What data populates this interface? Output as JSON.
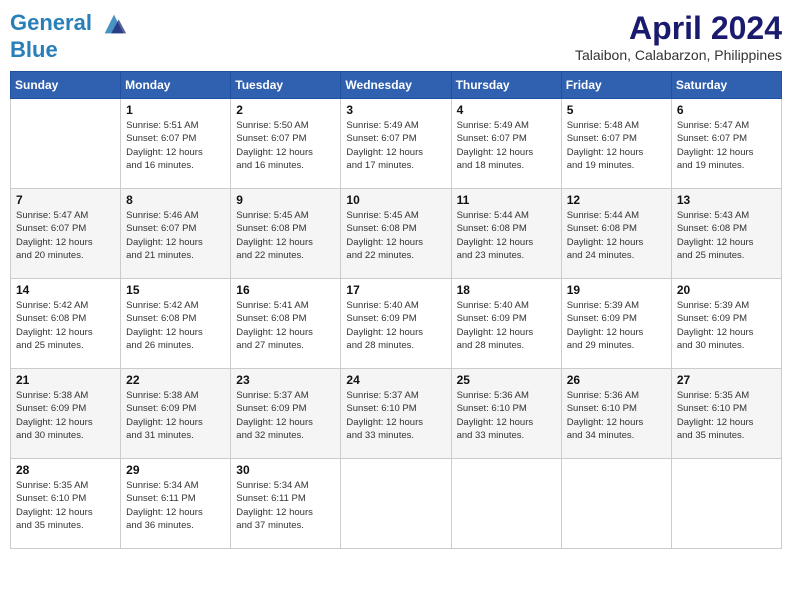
{
  "header": {
    "logo_line1": "General",
    "logo_line2": "Blue",
    "month": "April 2024",
    "location": "Talaibon, Calabarzon, Philippines"
  },
  "weekdays": [
    "Sunday",
    "Monday",
    "Tuesday",
    "Wednesday",
    "Thursday",
    "Friday",
    "Saturday"
  ],
  "weeks": [
    [
      {
        "day": "",
        "info": ""
      },
      {
        "day": "1",
        "info": "Sunrise: 5:51 AM\nSunset: 6:07 PM\nDaylight: 12 hours\nand 16 minutes."
      },
      {
        "day": "2",
        "info": "Sunrise: 5:50 AM\nSunset: 6:07 PM\nDaylight: 12 hours\nand 16 minutes."
      },
      {
        "day": "3",
        "info": "Sunrise: 5:49 AM\nSunset: 6:07 PM\nDaylight: 12 hours\nand 17 minutes."
      },
      {
        "day": "4",
        "info": "Sunrise: 5:49 AM\nSunset: 6:07 PM\nDaylight: 12 hours\nand 18 minutes."
      },
      {
        "day": "5",
        "info": "Sunrise: 5:48 AM\nSunset: 6:07 PM\nDaylight: 12 hours\nand 19 minutes."
      },
      {
        "day": "6",
        "info": "Sunrise: 5:47 AM\nSunset: 6:07 PM\nDaylight: 12 hours\nand 19 minutes."
      }
    ],
    [
      {
        "day": "7",
        "info": "Sunrise: 5:47 AM\nSunset: 6:07 PM\nDaylight: 12 hours\nand 20 minutes."
      },
      {
        "day": "8",
        "info": "Sunrise: 5:46 AM\nSunset: 6:07 PM\nDaylight: 12 hours\nand 21 minutes."
      },
      {
        "day": "9",
        "info": "Sunrise: 5:45 AM\nSunset: 6:08 PM\nDaylight: 12 hours\nand 22 minutes."
      },
      {
        "day": "10",
        "info": "Sunrise: 5:45 AM\nSunset: 6:08 PM\nDaylight: 12 hours\nand 22 minutes."
      },
      {
        "day": "11",
        "info": "Sunrise: 5:44 AM\nSunset: 6:08 PM\nDaylight: 12 hours\nand 23 minutes."
      },
      {
        "day": "12",
        "info": "Sunrise: 5:44 AM\nSunset: 6:08 PM\nDaylight: 12 hours\nand 24 minutes."
      },
      {
        "day": "13",
        "info": "Sunrise: 5:43 AM\nSunset: 6:08 PM\nDaylight: 12 hours\nand 25 minutes."
      }
    ],
    [
      {
        "day": "14",
        "info": "Sunrise: 5:42 AM\nSunset: 6:08 PM\nDaylight: 12 hours\nand 25 minutes."
      },
      {
        "day": "15",
        "info": "Sunrise: 5:42 AM\nSunset: 6:08 PM\nDaylight: 12 hours\nand 26 minutes."
      },
      {
        "day": "16",
        "info": "Sunrise: 5:41 AM\nSunset: 6:08 PM\nDaylight: 12 hours\nand 27 minutes."
      },
      {
        "day": "17",
        "info": "Sunrise: 5:40 AM\nSunset: 6:09 PM\nDaylight: 12 hours\nand 28 minutes."
      },
      {
        "day": "18",
        "info": "Sunrise: 5:40 AM\nSunset: 6:09 PM\nDaylight: 12 hours\nand 28 minutes."
      },
      {
        "day": "19",
        "info": "Sunrise: 5:39 AM\nSunset: 6:09 PM\nDaylight: 12 hours\nand 29 minutes."
      },
      {
        "day": "20",
        "info": "Sunrise: 5:39 AM\nSunset: 6:09 PM\nDaylight: 12 hours\nand 30 minutes."
      }
    ],
    [
      {
        "day": "21",
        "info": "Sunrise: 5:38 AM\nSunset: 6:09 PM\nDaylight: 12 hours\nand 30 minutes."
      },
      {
        "day": "22",
        "info": "Sunrise: 5:38 AM\nSunset: 6:09 PM\nDaylight: 12 hours\nand 31 minutes."
      },
      {
        "day": "23",
        "info": "Sunrise: 5:37 AM\nSunset: 6:09 PM\nDaylight: 12 hours\nand 32 minutes."
      },
      {
        "day": "24",
        "info": "Sunrise: 5:37 AM\nSunset: 6:10 PM\nDaylight: 12 hours\nand 33 minutes."
      },
      {
        "day": "25",
        "info": "Sunrise: 5:36 AM\nSunset: 6:10 PM\nDaylight: 12 hours\nand 33 minutes."
      },
      {
        "day": "26",
        "info": "Sunrise: 5:36 AM\nSunset: 6:10 PM\nDaylight: 12 hours\nand 34 minutes."
      },
      {
        "day": "27",
        "info": "Sunrise: 5:35 AM\nSunset: 6:10 PM\nDaylight: 12 hours\nand 35 minutes."
      }
    ],
    [
      {
        "day": "28",
        "info": "Sunrise: 5:35 AM\nSunset: 6:10 PM\nDaylight: 12 hours\nand 35 minutes."
      },
      {
        "day": "29",
        "info": "Sunrise: 5:34 AM\nSunset: 6:11 PM\nDaylight: 12 hours\nand 36 minutes."
      },
      {
        "day": "30",
        "info": "Sunrise: 5:34 AM\nSunset: 6:11 PM\nDaylight: 12 hours\nand 37 minutes."
      },
      {
        "day": "",
        "info": ""
      },
      {
        "day": "",
        "info": ""
      },
      {
        "day": "",
        "info": ""
      },
      {
        "day": "",
        "info": ""
      }
    ]
  ]
}
